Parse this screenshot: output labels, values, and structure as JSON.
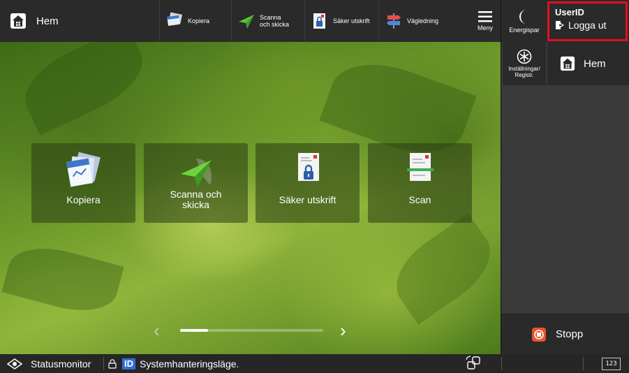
{
  "topbar": {
    "home_label": "Hem",
    "shortcuts": [
      {
        "label": "Kopiera",
        "icon": "copy-icon"
      },
      {
        "label": "Scanna och skicka",
        "icon": "send-plane-icon"
      },
      {
        "label": "Säker utskrift",
        "icon": "secure-print-icon"
      },
      {
        "label": "Vägledning",
        "icon": "signpost-icon"
      }
    ],
    "menu_label": "Meny",
    "energy_label": "Energispar",
    "user_id": "UserID",
    "logout_label": "Logga ut",
    "highlight_color": "#e01020"
  },
  "tiles": [
    {
      "label": "Kopiera",
      "icon": "copy-icon"
    },
    {
      "label": "Scanna och skicka",
      "icon": "send-plane-icon"
    },
    {
      "label": "Säker utskrift",
      "icon": "secure-print-icon"
    },
    {
      "label": "Scan",
      "icon": "scan-icon"
    }
  ],
  "pager": {
    "page": 1
  },
  "right_panel": {
    "settings_label": "Inställningar/ Registr.",
    "home_label": "Hem",
    "stop_label": "Stopp",
    "stop_color": "#e8552a"
  },
  "bottombar": {
    "status_label": "Statusmonitor",
    "id_badge": "ID",
    "mode_label": "Systemhanteringsläge.",
    "keypad_label": "123"
  }
}
